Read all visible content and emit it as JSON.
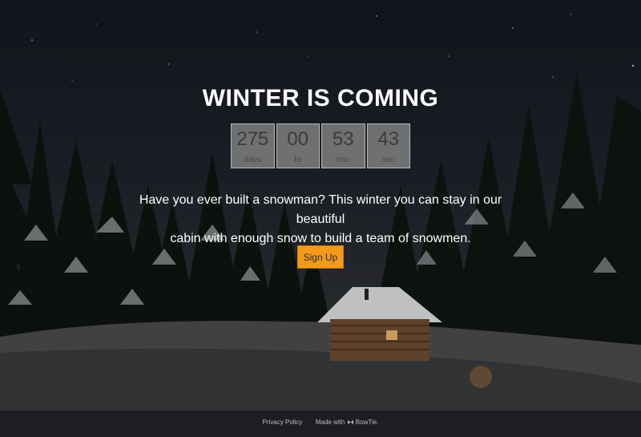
{
  "hero": {
    "title": "WINTER IS COMING",
    "description_line1": "Have you ever built a snowman? This winter you can stay in our beautiful",
    "description_line2": "cabin with enough snow to build a team of snowmen.",
    "signup_label": "Sign Up"
  },
  "countdown": [
    {
      "value": "275",
      "unit": "days"
    },
    {
      "value": "00",
      "unit": "hr"
    },
    {
      "value": "53",
      "unit": "min"
    },
    {
      "value": "43",
      "unit": "sec"
    }
  ],
  "footer": {
    "privacy_label": "Privacy Policy",
    "made_with_label": "Made with",
    "bowtie_icon": "bowtie-icon",
    "brand_label": "BowTie."
  },
  "colors": {
    "accent": "#f49a1b",
    "footer_bg": "#1d1e21"
  }
}
